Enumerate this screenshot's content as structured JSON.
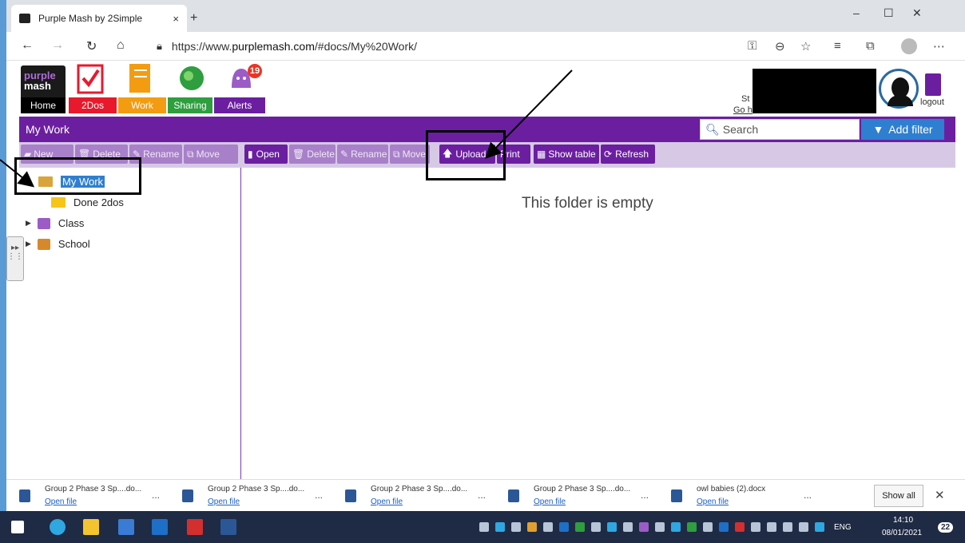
{
  "browser": {
    "tab_title": "Purple Mash by 2Simple",
    "tab_close": "×",
    "new_tab": "+",
    "win_min": "–",
    "win_max": "☐",
    "win_close": "✕",
    "url_prefix": "https://www.",
    "url_domain": "purplemash.com",
    "url_path": "/#docs/My%20Work/"
  },
  "app_nav": {
    "notification_count": "19",
    "items": [
      {
        "label": "Home",
        "color": "#000000"
      },
      {
        "label": "2Dos",
        "color": "#e8192c"
      },
      {
        "label": "Work",
        "color": "#f39c12"
      },
      {
        "label": "Sharing",
        "color": "#2e9e3e"
      },
      {
        "label": "Alerts",
        "color": "#6b1fa0"
      }
    ],
    "user_name_fragment": "St",
    "user_go_fragment": "Go h",
    "logout_label": "logout"
  },
  "titlebar": {
    "title": "My Work",
    "search_placeholder": "Search",
    "add_filter": "Add filter"
  },
  "left_toolbar": [
    "New",
    "Delete",
    "Rename",
    "Move"
  ],
  "main_toolbar": [
    "Open",
    "Delete",
    "Rename",
    "Move",
    "Upload",
    "Print",
    "Show table",
    "Refresh"
  ],
  "tree": {
    "items": [
      {
        "label": "My Work"
      },
      {
        "label": "Done 2dos"
      },
      {
        "label": "Class"
      },
      {
        "label": "School"
      }
    ]
  },
  "main": {
    "empty_message": "This folder is empty"
  },
  "downloads": {
    "items": [
      {
        "name": "Group 2 Phase 3 Sp....do...",
        "action": "Open file"
      },
      {
        "name": "Group 2 Phase 3 Sp....do...",
        "action": "Open file"
      },
      {
        "name": "Group 2 Phase 3 Sp....do...",
        "action": "Open file"
      },
      {
        "name": "Group 2 Phase 3 Sp....do...",
        "action": "Open file"
      },
      {
        "name": "owl babies (2).docx",
        "action": "Open file"
      }
    ],
    "more": "...",
    "show_all": "Show all",
    "close": "✕"
  },
  "taskbar": {
    "lang": "ENG",
    "time": "14:10",
    "date": "08/01/2021",
    "notif_count": "22"
  }
}
